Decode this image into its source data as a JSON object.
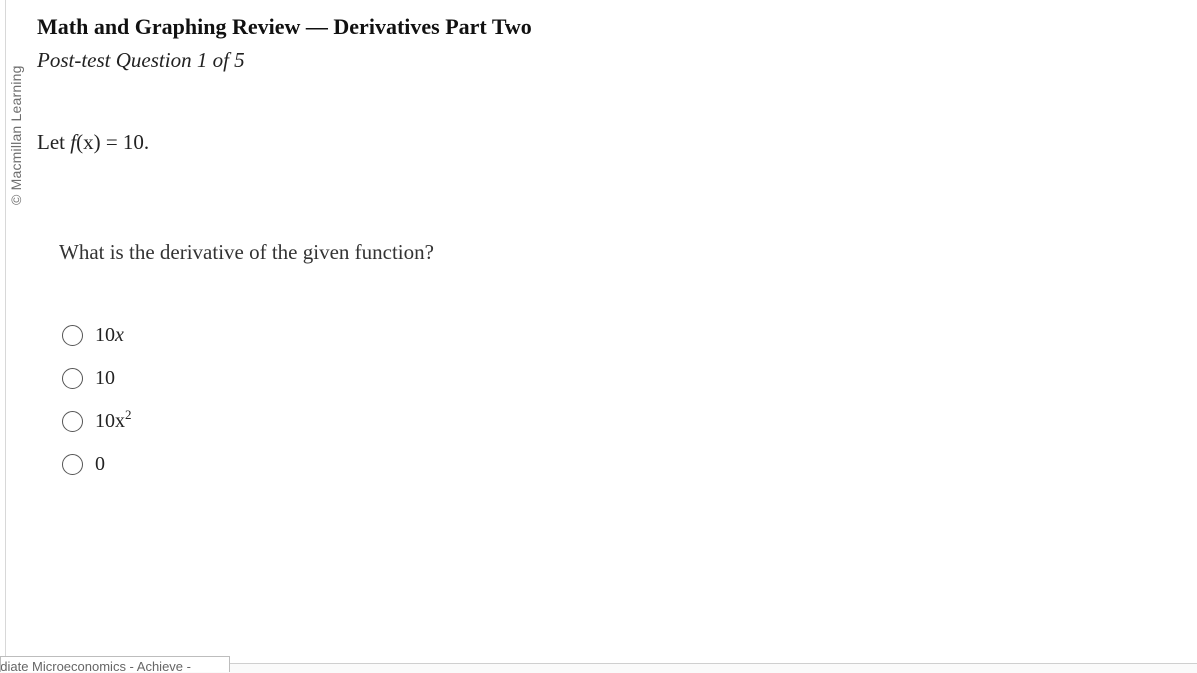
{
  "watermark": "© Macmillan Learning",
  "header": {
    "title": "Math and Graphing Review — Derivatives Part Two",
    "subtitle": "Post-test Question 1 of 5"
  },
  "problem": {
    "statement_prefix": "Let ",
    "function_name": "f",
    "function_arg": "(x)",
    "equals": " = ",
    "function_value": "10."
  },
  "question": "What is the derivative of the given function?",
  "options": [
    {
      "coef": "10",
      "var": "x",
      "exp": ""
    },
    {
      "coef": "10",
      "var": "",
      "exp": ""
    },
    {
      "coef": "10x",
      "var": "",
      "exp": "2"
    },
    {
      "coef": "0",
      "var": "",
      "exp": ""
    }
  ],
  "footer": {
    "tab_label": "ediate Microeconomics - Achieve -"
  }
}
